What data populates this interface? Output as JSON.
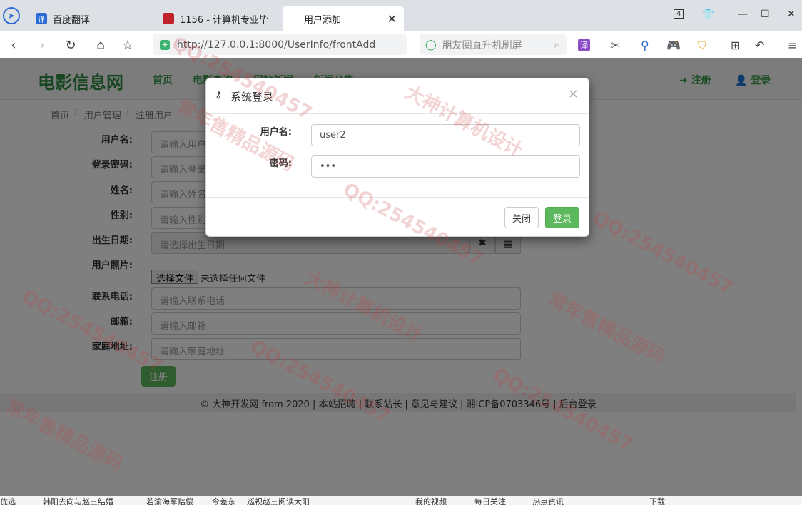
{
  "browser": {
    "tabs": [
      {
        "label": "百度翻译",
        "icon_char": "译",
        "active": false
      },
      {
        "label": "1156 - 计算机专业毕",
        "icon_char": "",
        "active": false
      },
      {
        "label": "用户添加",
        "icon_char": "",
        "active": true
      }
    ],
    "tab_count_badge": "4",
    "url": "http://127.0.0.1:8000/UserInfo/frontAdd",
    "search_placeholder": "朋友圈直升机刷屏"
  },
  "site": {
    "brand": "电影信息网",
    "menu": [
      "首页",
      "电影查询",
      "网站新闻",
      "新闻公告"
    ],
    "register_link": "注册",
    "login_link": "登录",
    "breadcrumb": [
      "首页",
      "用户管理",
      "注册用户"
    ],
    "form": {
      "username_label": "用户名:",
      "username_placeholder": "请输入用户名",
      "password_label": "登录密码:",
      "password_placeholder": "请输入登录密码",
      "name_label": "姓名:",
      "name_placeholder": "请输入姓名",
      "gender_label": "性别:",
      "gender_placeholder": "请输入性别",
      "birth_label": "出生日期:",
      "birth_placeholder": "请选择出生日期",
      "photo_label": "用户照片:",
      "file_button": "选择文件",
      "file_status": "未选择任何文件",
      "phone_label": "联系电话:",
      "phone_placeholder": "请输入联系电话",
      "email_label": "邮箱:",
      "email_placeholder": "请输入邮箱",
      "address_label": "家庭地址:",
      "address_placeholder": "请输入家庭地址",
      "submit": "注册"
    },
    "footer": "© 大神开发网 from 2020 | 本站招聘 | 联系站长 | 意见与建议 | 湘ICP备0703346号 | 后台登录"
  },
  "modal": {
    "title": "系统登录",
    "username_label": "用户名:",
    "username_value": "user2",
    "password_label": "密码:",
    "password_value": "•••",
    "close_button": "关闭",
    "login_button": "登录"
  },
  "statusbar": {
    "items": [
      "优选",
      "韩阳去向与赵三结婚",
      "若渝海军赔偿",
      "今差东",
      "巡视赵三阅读大阳",
      "我的视频",
      "每日关注",
      "热点资讯",
      "下载"
    ]
  },
  "watermarks": [
    "QQ:254540457",
    "大神计算机设计",
    "常年售精品源码"
  ]
}
